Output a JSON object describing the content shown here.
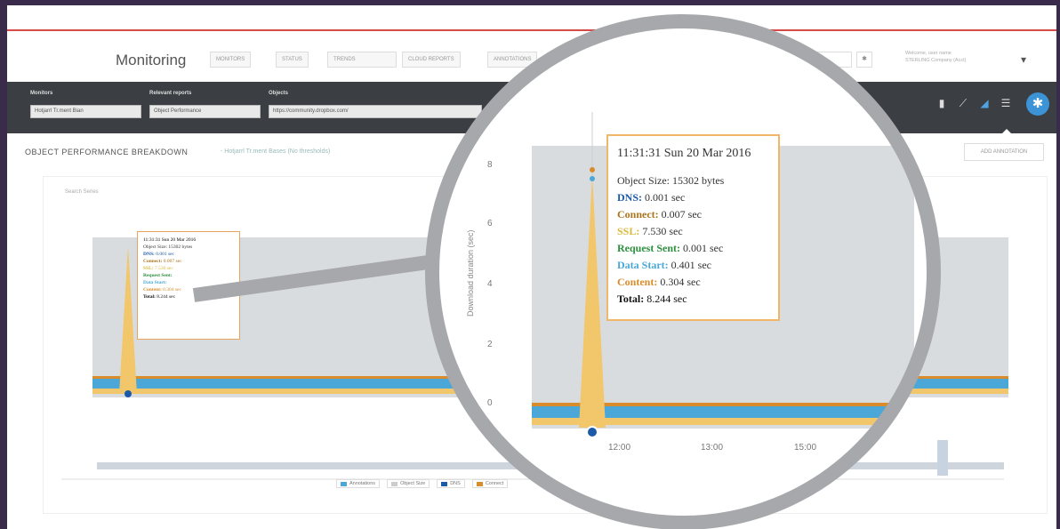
{
  "header": {
    "title": "Monitoring",
    "tabs": [
      "MONITORS",
      "STATUS",
      "TRENDS",
      "CLOUD REPORTS",
      "ANNOTATIONS"
    ],
    "right_select": "Custom Dataset",
    "user_line1": "Welcome, user name",
    "user_line2": "STERLING Company (Acct)"
  },
  "filters": {
    "monitors_label": "Monitors",
    "monitors_value": "Hotjarrl Tr.ment Bian",
    "reports_label": "Relevant reports",
    "reports_value": "Object Performance",
    "objects_label": "Objects",
    "objects_value": "https://community.dropbox.com/"
  },
  "section": {
    "title": "OBJECT PERFORMANCE BREAKDOWN",
    "subtitle": "- Hotjarrl Tr.ment Bases (No thresholds)",
    "add_annotation": "ADD ANNOTATION",
    "search_placeholder": "Search Series"
  },
  "tooltip": {
    "time": "11:31:31 Sun 20 Mar 2016",
    "object_size_label": "Object Size:",
    "object_size_value": "15302 bytes",
    "dns_label": "DNS:",
    "dns_value": "0.001 sec",
    "connect_label": "Connect:",
    "connect_value": "0.007 sec",
    "ssl_label": "SSL:",
    "ssl_value": "7.530 sec",
    "request_label": "Request Sent:",
    "request_value": "0.001 sec",
    "datastart_label": "Data Start:",
    "datastart_value": "0.401 sec",
    "content_label": "Content:",
    "content_value": "0.304 sec",
    "total_label": "Total:",
    "total_value": "8.244 sec"
  },
  "chart_data": {
    "type": "area",
    "ylabel": "Download duration (sec)",
    "y_ticks": [
      "0",
      "2",
      "4",
      "6",
      "8"
    ],
    "x_ticks": [
      "12:00",
      "13:00",
      "15:00"
    ],
    "series": [
      {
        "name": "Connect",
        "color": "#a8741e"
      },
      {
        "name": "SSL",
        "color": "#f2c66b"
      },
      {
        "name": "Data Start",
        "color": "#4aa7d8"
      },
      {
        "name": "Content",
        "color": "#d98c2b"
      }
    ],
    "peak": {
      "time": "11:31:31 Sun 20 Mar 2016",
      "total": 8.244
    }
  },
  "legend": [
    "Annotations",
    "Object Size",
    "DNS",
    "Connect"
  ],
  "colors": {
    "filterbar": "#3b3e43",
    "accent": "#3c94d6",
    "ssl": "#f2c66b",
    "datastart": "#4aa7d8"
  }
}
